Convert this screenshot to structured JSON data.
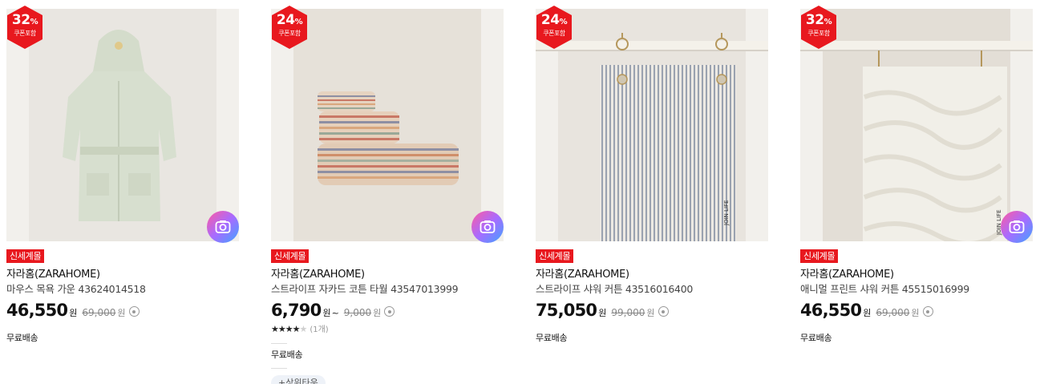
{
  "products": [
    {
      "discount": "32",
      "discount_unit": "%",
      "coupon_label": "쿠폰포함",
      "tag": "신세계몰",
      "brand": "자라홈(ZARAHOME)",
      "name": "마우스 목욕 가운 43624014518",
      "price": "46,550",
      "price_unit": "원",
      "original_price": "69,000",
      "original_unit": "원",
      "shipping": "무료배송",
      "image_icon": "bathrobe-image"
    },
    {
      "discount": "24",
      "discount_unit": "%",
      "coupon_label": "쿠폰포함",
      "tag": "신세계몰",
      "brand": "자라홈(ZARAHOME)",
      "name": "스트라이프 자카드 코튼 타월 43547013999",
      "price": "6,790",
      "price_unit": "원",
      "price_suffix": "~",
      "original_price": "9,000",
      "original_unit": "원",
      "rating_stars": 4,
      "rating_count": "(1개)",
      "shipping": "무료배송",
      "more_pill": "+상위타운",
      "image_icon": "towel-stack-image"
    },
    {
      "discount": "24",
      "discount_unit": "%",
      "coupon_label": "쿠폰포함",
      "tag": "신세계몰",
      "brand": "자라홈(ZARAHOME)",
      "name": "스트라이프 샤워 커튼 43516016400",
      "price": "75,050",
      "price_unit": "원",
      "original_price": "99,000",
      "original_unit": "원",
      "shipping": "무료배송",
      "image_icon": "striped-curtain-image"
    },
    {
      "discount": "32",
      "discount_unit": "%",
      "coupon_label": "쿠폰포함",
      "tag": "신세계몰",
      "brand": "자라홈(ZARAHOME)",
      "name": "애니멀 프린트 샤워 커튼 45515016999",
      "price": "46,550",
      "price_unit": "원",
      "original_price": "69,000",
      "original_unit": "원",
      "shipping": "무료배송",
      "curtain_label": "JOIN LIFE",
      "image_icon": "animal-print-curtain-image"
    }
  ],
  "colors": {
    "badge_red": "#e8181e",
    "tag_red": "#e8181e",
    "image_bg": "#e7e4df"
  }
}
